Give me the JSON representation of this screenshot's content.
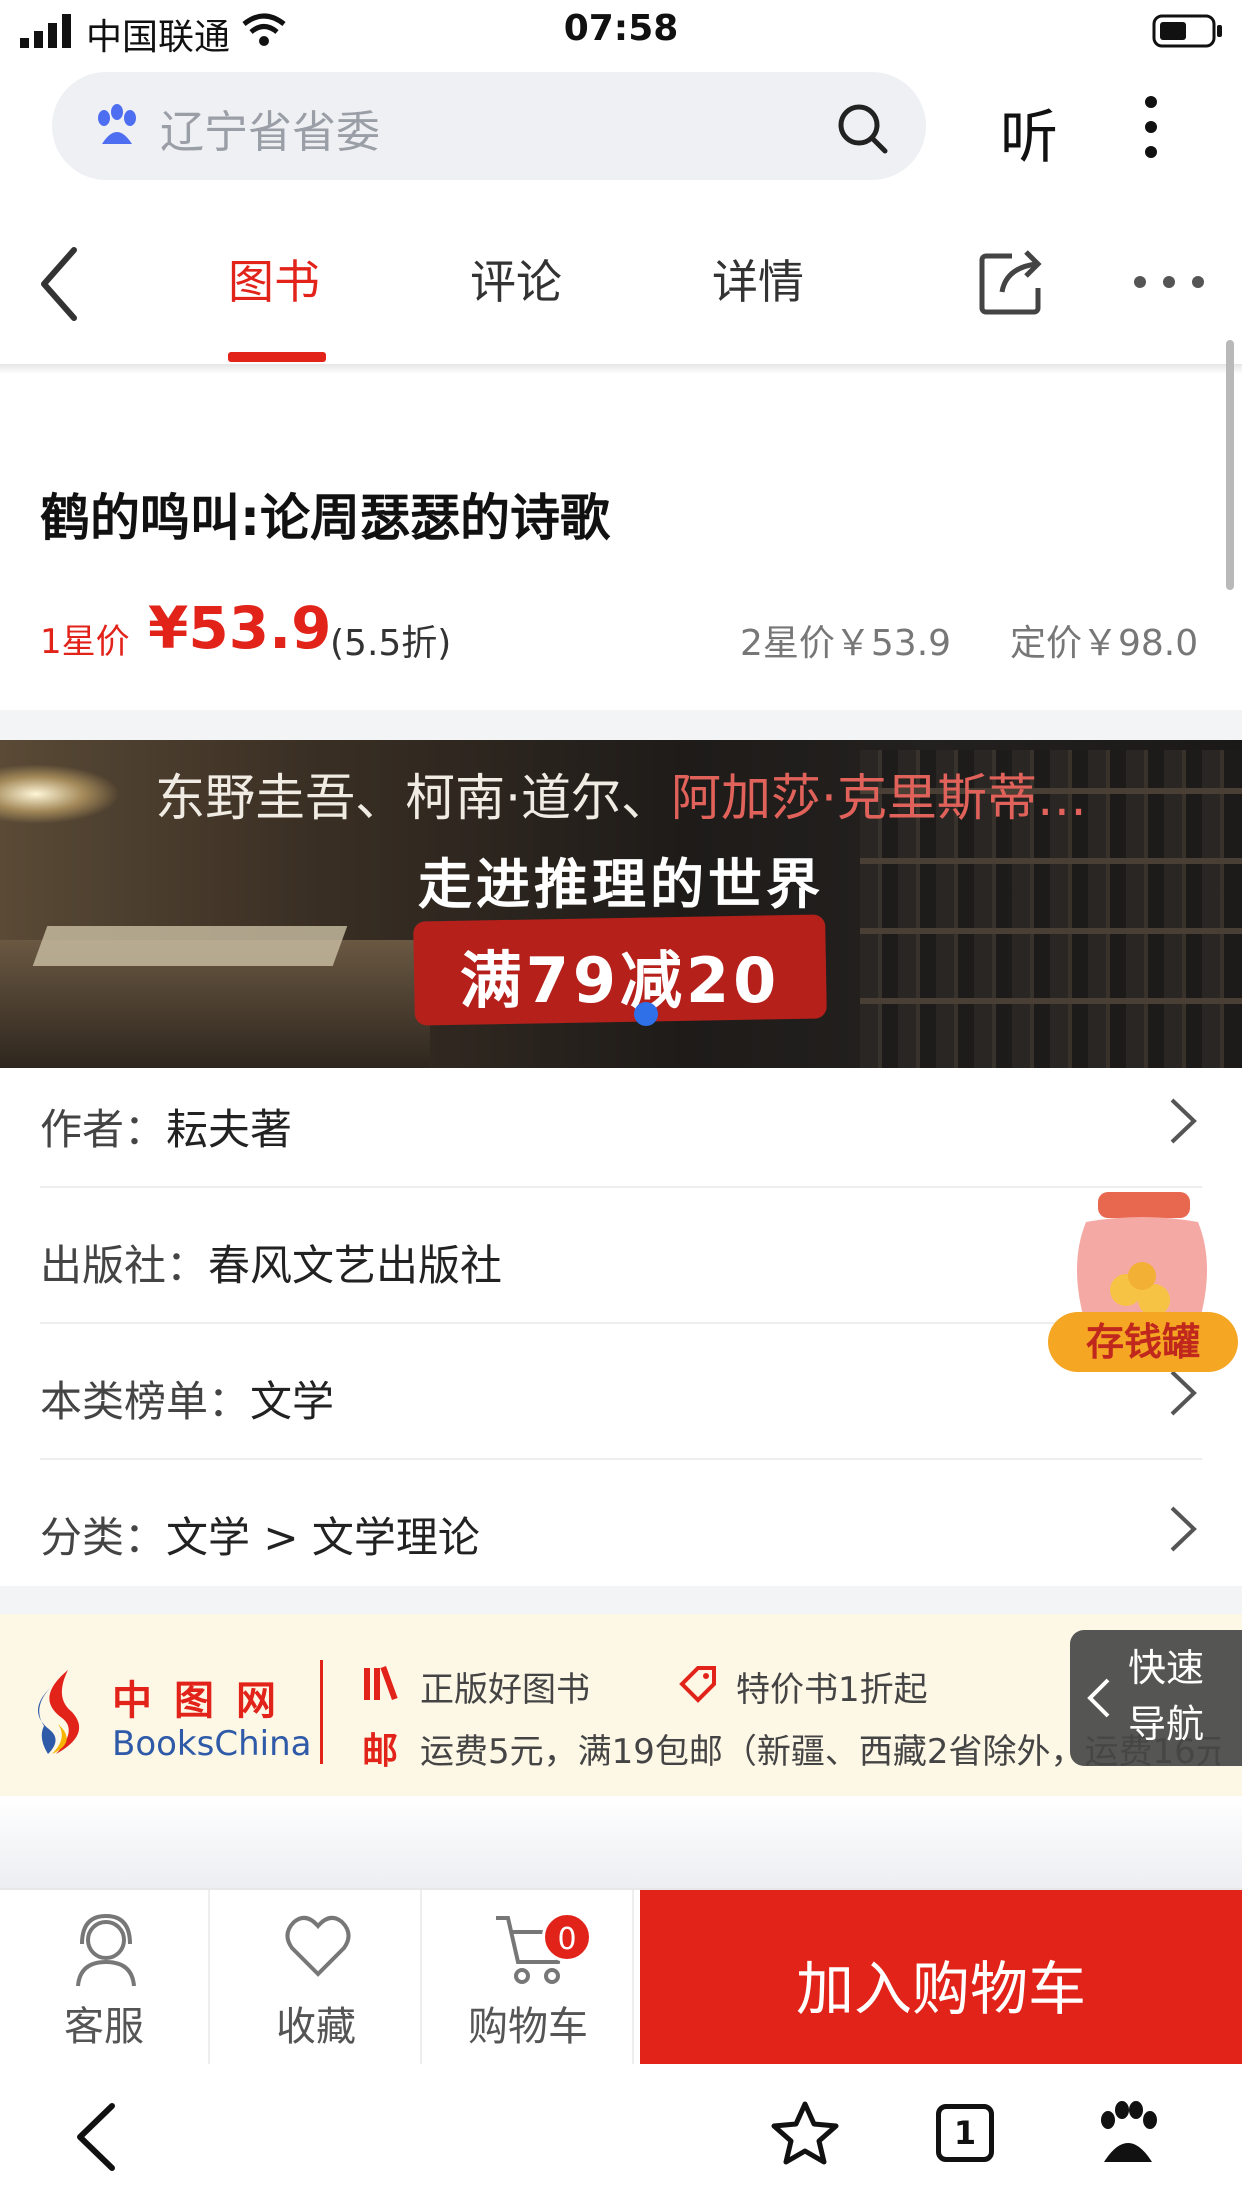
{
  "status_bar": {
    "carrier": "中国联通",
    "time": "07:58"
  },
  "search": {
    "query": "辽宁省省委",
    "listen_label": "听"
  },
  "nav_tabs": [
    {
      "label": "图书",
      "active": true
    },
    {
      "label": "评论",
      "active": false
    },
    {
      "label": "详情",
      "active": false
    }
  ],
  "book": {
    "title": "鹤的鸣叫:论周瑟瑟的诗歌",
    "star1_label": "1星价",
    "star1_price": "¥53.9",
    "discount": "(5.5折)",
    "star2_price": "2星价￥53.9",
    "list_price": "定价￥98.0"
  },
  "banner": {
    "line1_white": "东野圭吾、柯南·道尔、",
    "line1_red": "阿加莎·克里斯蒂…",
    "line2": "走进推理的世界",
    "line3": "满79减20"
  },
  "info_rows": [
    {
      "label": "作者：",
      "value": "耘夫著"
    },
    {
      "label": "出版社：",
      "value": "春风文艺出版社"
    },
    {
      "label": "本类榜单：",
      "value": "文学"
    },
    {
      "label": "分类：",
      "value": "文学 > 文学理论"
    }
  ],
  "floating": {
    "piggy_bank": "存钱罐",
    "quick_nav": "快速导航"
  },
  "bookschina": {
    "name_cn": "中图网",
    "name_en": "BooksChina",
    "feature1": "正版好图书",
    "feature2": "特价书1折起",
    "mail_icon_text": "邮",
    "shipping": "运费5元，满19包邮（新疆、西藏2省除外，运费16元起）"
  },
  "action_bar": {
    "service": "客服",
    "favorite": "收藏",
    "cart": "购物车",
    "cart_count": "0",
    "add_to_cart": "加入购物车"
  },
  "browser_bar": {
    "tab_count": "1"
  },
  "colors": {
    "accent": "#e2231a",
    "link_blue": "#2e5aa8",
    "strip_bg": "#fdf7e6"
  }
}
